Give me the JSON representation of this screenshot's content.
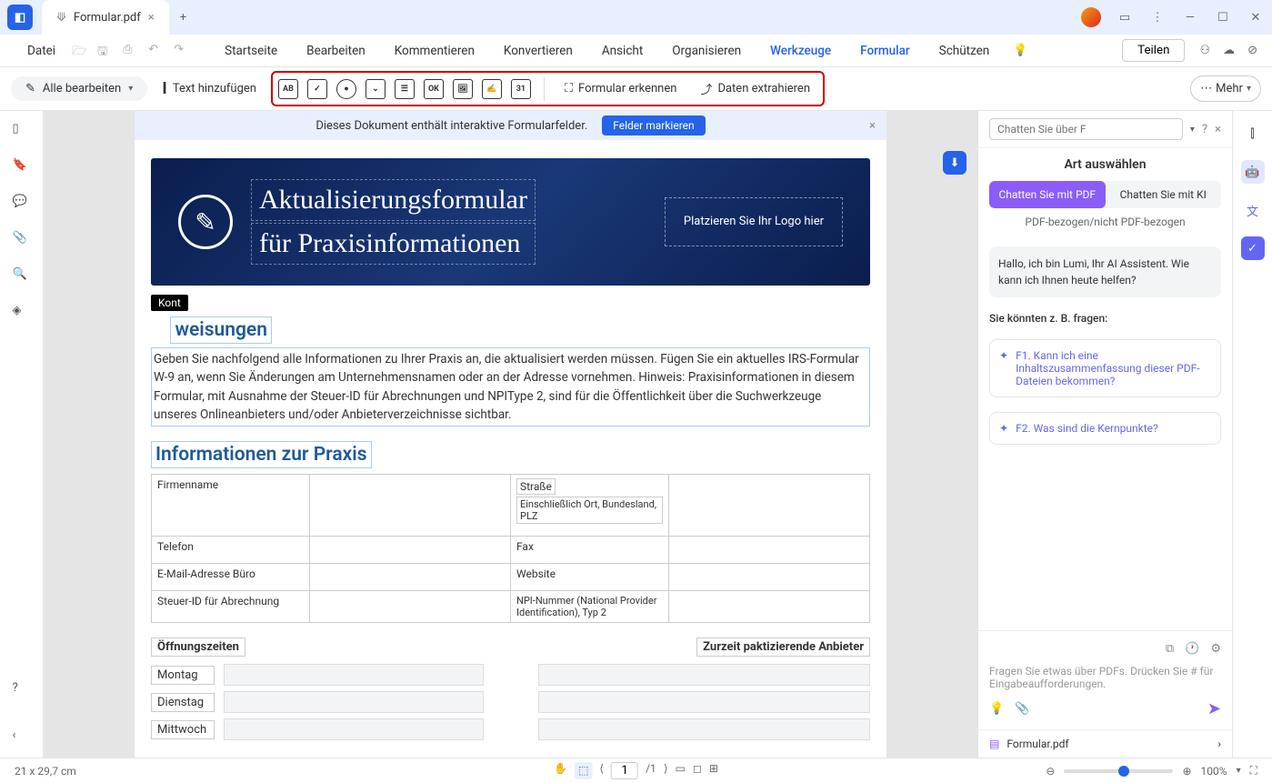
{
  "titlebar": {
    "filename": "Formular.pdf"
  },
  "menu": {
    "file": "Datei",
    "start": "Startseite",
    "edit": "Bearbeiten",
    "comment": "Kommentieren",
    "convert": "Konvertieren",
    "view": "Ansicht",
    "organize": "Organisieren",
    "tools": "Werkzeuge",
    "form": "Formular",
    "protect": "Schützen",
    "share": "Teilen"
  },
  "toolbar": {
    "editAll": "Alle bearbeiten",
    "addText": "Text hinzufügen",
    "recognize": "Formular erkennen",
    "extract": "Daten extrahieren",
    "more": "Mehr"
  },
  "banner": {
    "text": "Dieses Dokument enthält interaktive Formularfelder.",
    "button": "Felder markieren"
  },
  "doc": {
    "kont": "Kont",
    "title1": "Aktualisierungsformular",
    "title2": "für Praxisinformationen",
    "logo": "Platzieren Sie Ihr Logo hier",
    "sec1": "weisungen",
    "body": "Geben Sie nachfolgend alle Informationen zu Ihrer Praxis an, die aktualisiert werden müssen. Fügen Sie ein aktuelles IRS-Formular W-9 an, wenn Sie Änderungen am Unternehmensnamen oder an der Adresse vornehmen. Hinweis: Praxisinformationen in diesem Formular, mit Ausnahme der Steuer-ID für Abrechnungen und NPIType 2, sind für die Öffentlichkeit über die Suchwerkzeuge unseres Onlineanbieters und/oder Anbieterverzeichnisse sichtbar.",
    "sec2": "Informationen zur Praxis",
    "labels": {
      "firma": "Firmenname",
      "strasse": "Straße",
      "ort": "Einschließlich Ort, Bundesland, PLZ",
      "tel": "Telefon",
      "fax": "Fax",
      "email": "E-Mail-Adresse Büro",
      "web": "Website",
      "steuer": "Steuer-ID für Abrechnung",
      "npi": "NPI-Nummer (National Provider Identification), Typ 2"
    },
    "sched1": "Öffnungszeiten",
    "sched2": "Zurzeit paktizierende Anbieter",
    "days": {
      "mo": "Montag",
      "di": "Dienstag",
      "mi": "Mittwoch"
    }
  },
  "rpanel": {
    "chatPlaceholder": "Chatten Sie über F",
    "title": "Art auswählen",
    "tog1": "Chatten Sie mit PDF",
    "tog2": "Chatten Sie mit KI",
    "sub": "PDF-bezogen/nicht PDF-bezogen",
    "greeting": "Hallo, ich bin Lumi, Ihr AI Assistent. Wie kann ich Ihnen heute helfen?",
    "suggest": "Sie könnten z. B. fragen:",
    "q1": "F1. Kann ich eine Inhaltszusammenfassung dieser PDF-Dateien bekommen?",
    "q2": "F2. Was sind die Kernpunkte?",
    "prompt": "Fragen Sie etwas über PDFs. Drücken Sie # für Eingabeaufforderungen.",
    "file": "Formular.pdf"
  },
  "status": {
    "dim": "21 x 29,7 cm",
    "page": "1",
    "pages": "/1",
    "zoom": "100%"
  }
}
